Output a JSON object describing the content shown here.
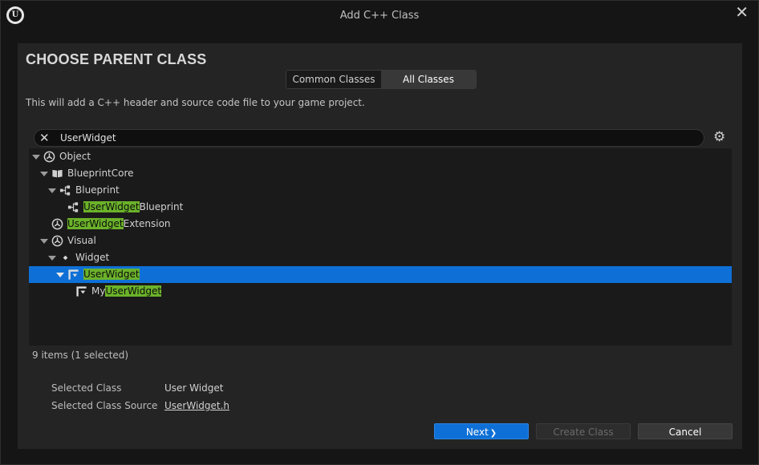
{
  "window": {
    "title": "Add C++ Class",
    "close_glyph": "✕",
    "logo_glyph": "U"
  },
  "heading": "CHOOSE PARENT CLASS",
  "tabs": [
    {
      "label": "Common Classes",
      "active": false
    },
    {
      "label": "All Classes",
      "active": true
    }
  ],
  "description": "This will add a C++ header and source code file to your game project.",
  "search": {
    "value": "UserWidget",
    "clear_glyph": "✕",
    "settings_icon": "gear-icon"
  },
  "tree": {
    "highlight": "UserWidget",
    "rows": [
      {
        "pre": "",
        "match": "",
        "post": "Object",
        "icon": "class-icon",
        "depth": 0,
        "expanded": true,
        "selected": false
      },
      {
        "pre": "",
        "match": "",
        "post": "BlueprintCore",
        "icon": "book-icon",
        "depth": 1,
        "expanded": true,
        "selected": false
      },
      {
        "pre": "",
        "match": "",
        "post": "Blueprint",
        "icon": "blueprint-icon",
        "depth": 2,
        "expanded": true,
        "selected": false
      },
      {
        "pre": "",
        "match": "UserWidget",
        "post": "Blueprint",
        "icon": "blueprint-icon",
        "depth": 3,
        "expanded": null,
        "selected": false
      },
      {
        "pre": "",
        "match": "UserWidget",
        "post": "Extension",
        "icon": "class-icon",
        "depth": 1,
        "expanded": null,
        "selected": false
      },
      {
        "pre": "",
        "match": "",
        "post": "Visual",
        "icon": "class-icon",
        "depth": 1,
        "expanded": true,
        "selected": false
      },
      {
        "pre": "",
        "match": "",
        "post": "Widget",
        "icon": "dot-icon",
        "depth": 2,
        "expanded": true,
        "selected": false
      },
      {
        "pre": "",
        "match": "UserWidget",
        "post": "",
        "icon": "user-widget-icon",
        "depth": 3,
        "expanded": true,
        "selected": true
      },
      {
        "pre": "My",
        "match": "UserWidget",
        "post": "",
        "icon": "user-widget-icon",
        "depth": 4,
        "expanded": null,
        "selected": false
      }
    ]
  },
  "count_text": "9 items (1 selected)",
  "info": {
    "selected_class_label": "Selected Class",
    "selected_class_value": "User Widget",
    "source_label": "Selected Class Source",
    "source_value": "UserWidget.h"
  },
  "buttons": {
    "next": "Next",
    "next_glyph": "❯",
    "create": "Create Class",
    "cancel": "Cancel"
  },
  "colors": {
    "accent": "#0e70d6",
    "highlight": "#6bb22a"
  }
}
